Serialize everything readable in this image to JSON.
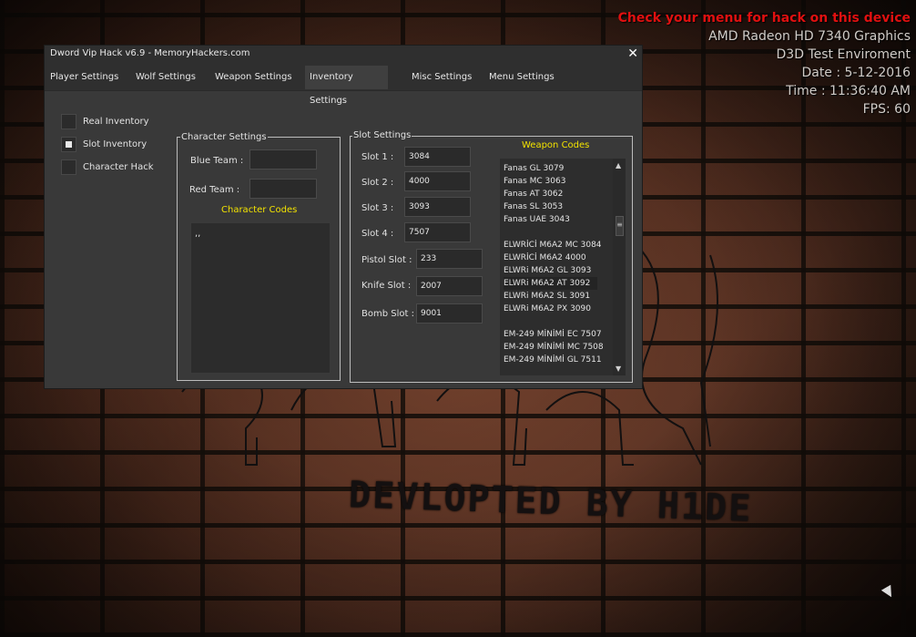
{
  "background": {
    "graffiti_text": "DEVLOPTED BY H1DE"
  },
  "overlay": {
    "warning": "Check  your menu for hack on this device",
    "gpu": "AMD Radeon HD 7340 Graphics",
    "env": "D3D Test Enviroment",
    "date": "Date : 5-12-2016",
    "time": "Time : 11:36:40 AM",
    "fps": "FPS:  60"
  },
  "window": {
    "title": "Dword Vip Hack v6.9 - MemoryHackers.com",
    "close_glyph": "✕",
    "tabs": [
      {
        "label": "Player Settings"
      },
      {
        "label": "Wolf Settings"
      },
      {
        "label": "Weapon Settings"
      },
      {
        "label": "Inventory Settings"
      },
      {
        "label": "Misc Settings"
      },
      {
        "label": "Menu Settings"
      }
    ],
    "active_tab": "Inventory Settings"
  },
  "options": [
    {
      "label": "Real Inventory",
      "checked": false
    },
    {
      "label": "Slot Inventory",
      "checked": true
    },
    {
      "label": "Character Hack",
      "checked": false
    }
  ],
  "character": {
    "group_title": "Character Settings",
    "blue_label": "Blue Team :",
    "blue_value": "",
    "red_label": "Red Team :",
    "red_value": "",
    "codes_title": "Character Codes",
    "codes_text": ",,"
  },
  "slots": {
    "group_title": "Slot Settings",
    "fields": [
      {
        "label": "Slot 1 :",
        "value": "3084"
      },
      {
        "label": "Slot 2 :",
        "value": "4000"
      },
      {
        "label": "Slot 3 :",
        "value": "3093"
      },
      {
        "label": "Slot 4 :",
        "value": "7507"
      },
      {
        "label": "Pistol Slot :",
        "value": "233"
      },
      {
        "label": "Knife Slot :",
        "value": "2007"
      },
      {
        "label": "Bomb Slot :",
        "value": "9001"
      }
    ],
    "weapon_codes_title": "Weapon Codes",
    "weapon_codes": [
      "Fanas GL 3079",
      "Fanas MC 3063",
      "Fanas AT 3062",
      "Fanas SL 3053",
      "Fanas UAE 3043",
      "",
      "ELWRİCİ M6A2 MC 3084",
      "ELWRİCİ M6A2 4000",
      "ELWRi M6A2 GL 3093",
      "ELWRi M6A2 AT 3092",
      "ELWRi M6A2 SL 3091",
      "ELWRi M6A2 PX 3090",
      "",
      "EM-249 MİNİMİ EC 7507",
      "EM-249 MİNİMİ MC 7508",
      "EM-249 MİNİMİ GL 7511"
    ],
    "selected_code": "ELWRi M6A2 AT 3092"
  }
}
